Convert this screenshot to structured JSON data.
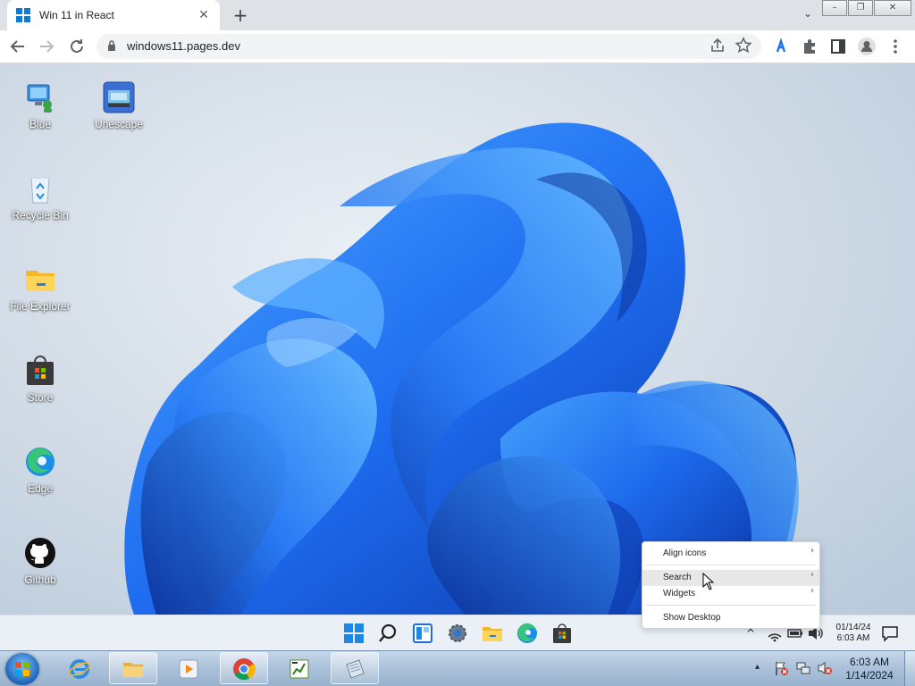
{
  "browser": {
    "tab_title": "Win 11 in React",
    "tab_close": "✕",
    "new_tab": "+",
    "tab_dropdown": "⌄",
    "url": "windows11.pages.dev",
    "window_controls": {
      "minimize": "–",
      "restore": "❐",
      "close": "✕"
    }
  },
  "desktop_icons": [
    {
      "label": "Blue"
    },
    {
      "label": "Unescape"
    },
    {
      "label": "Recycle Bin"
    },
    {
      "label": "File Explorer"
    },
    {
      "label": "Store"
    },
    {
      "label": "Edge"
    },
    {
      "label": "Github"
    }
  ],
  "context_menu": {
    "items": [
      {
        "label": "Align icons",
        "submenu": true
      },
      {
        "label": "Search",
        "submenu": true,
        "hovered": true
      },
      {
        "label": "Widgets",
        "submenu": true
      },
      {
        "label": "Show Desktop",
        "submenu": false
      }
    ],
    "arrow": "›"
  },
  "win11_taskbar": {
    "icons": [
      "start-icon",
      "search-icon",
      "widgets-icon",
      "settings-icon",
      "file-explorer-icon",
      "edge-icon",
      "store-icon"
    ],
    "clock": {
      "date": "01/14/24",
      "time": "6:03 AM"
    },
    "tray_chevron": "^"
  },
  "win7_taskbar": {
    "clock": {
      "time": "6:03 AM",
      "date": "1/14/2024"
    },
    "tray_chevron": "▴"
  },
  "colors": {
    "accent": "#0a7cd6",
    "bloom_dark": "#0a3fb8",
    "bloom_light": "#3b9bff"
  }
}
